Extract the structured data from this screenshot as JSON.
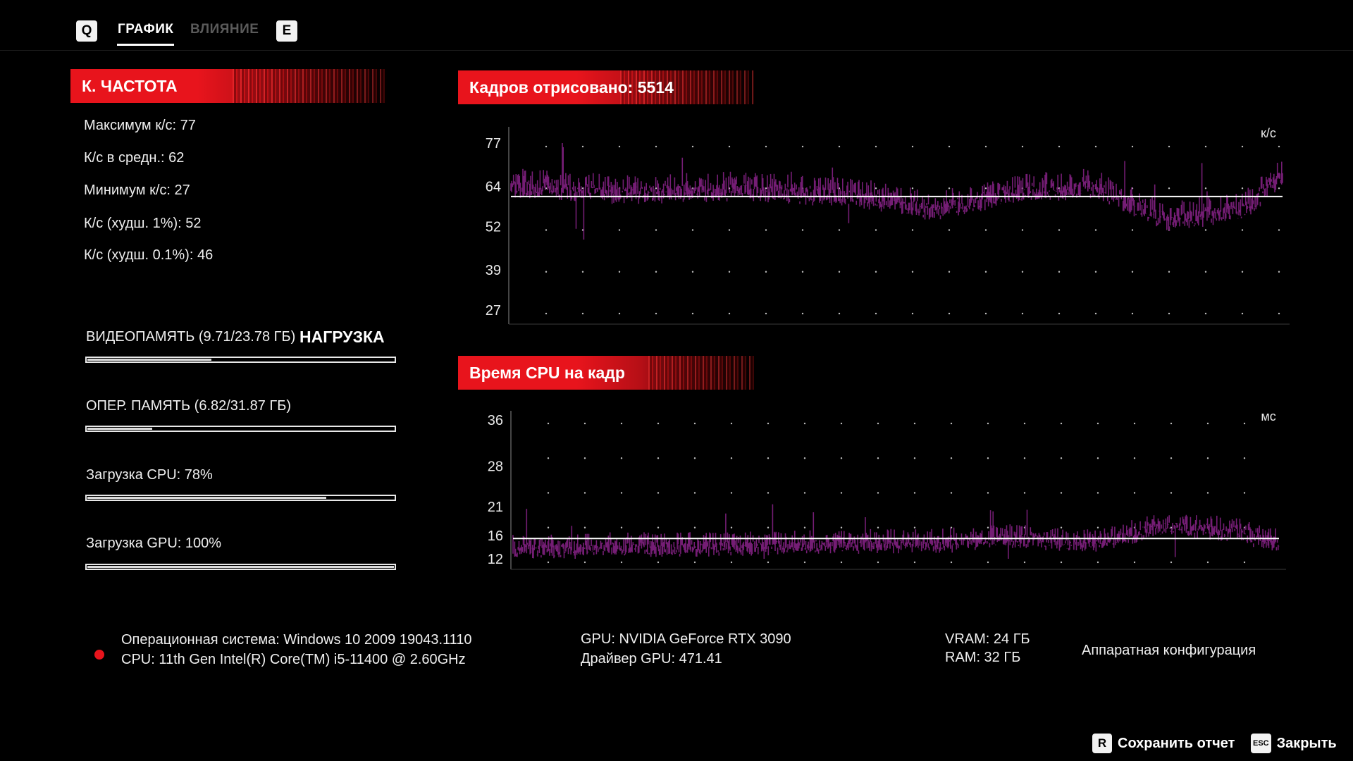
{
  "tabs": {
    "prev_key": "Q",
    "next_key": "E",
    "items": [
      {
        "label": "ГРАФИК",
        "active": true
      },
      {
        "label": "ВЛИЯНИЕ",
        "active": false
      }
    ]
  },
  "fps_section": {
    "title": "К. ЧАСТОТА",
    "stats": [
      "Максимум к/с: 77",
      "К/с в средн.: 62",
      "Минимум к/с: 27",
      "К/с (худш. 1%): 52",
      "К/с (худш. 0.1%): 46"
    ]
  },
  "load_section": {
    "title": "НАГРУЗКА",
    "bars": [
      {
        "label": "ВИДЕОПАМЯТЬ (9.71/23.78 ГБ)",
        "fraction": 0.408
      },
      {
        "label": "ОПЕР. ПАМЯТЬ (6.82/31.87 ГБ)",
        "fraction": 0.214
      },
      {
        "label": "Загрузка CPU: 78%",
        "fraction": 0.78
      },
      {
        "label": "Загрузка GPU: 100%",
        "fraction": 1.0
      }
    ]
  },
  "chart_data": [
    {
      "type": "line",
      "title": "Кадров отрисовано: 5514",
      "unit": "к/с",
      "yticks": [
        77,
        64,
        52,
        39,
        27
      ],
      "ylim": [
        27,
        77
      ],
      "average": 61,
      "series_color": "#7a1f7a",
      "average_color": "#ffffff",
      "segments": [
        {
          "x": [
            0,
            0.15,
            0.3,
            0.45,
            0.55,
            0.65,
            0.755,
            0.85,
            0.95,
            1.0
          ],
          "mean": [
            65,
            63,
            64,
            62,
            58,
            63,
            65,
            55,
            58,
            68
          ]
        }
      ]
    },
    {
      "type": "line",
      "title": "Время CPU на кадр",
      "unit": "мс",
      "yticks": [
        36,
        28,
        21,
        16,
        12
      ],
      "ylim": [
        12,
        36
      ],
      "average": 15.5,
      "series_color": "#7a1f7a",
      "average_color": "#ffffff",
      "segments": [
        {
          "x": [
            0,
            0.15,
            0.3,
            0.45,
            0.55,
            0.65,
            0.755,
            0.85,
            0.95,
            1.0
          ],
          "mean": [
            14,
            14.5,
            14.5,
            15,
            15,
            16,
            15,
            18,
            17,
            15
          ]
        }
      ]
    }
  ],
  "system": {
    "os": "Операционная система: Windows 10 2009 19043.1110",
    "cpu": "CPU: 11th Gen Intel(R) Core(TM) i5-11400 @ 2.60GHz",
    "gpu": "GPU: NVIDIA GeForce RTX 3090",
    "driver": "Драйвер GPU: 471.41",
    "vram": "VRAM: 24 ГБ",
    "ram": "RAM: 32 ГБ",
    "hw_config": "Аппаратная конфигурация"
  },
  "actions": {
    "save_key": "R",
    "save_label": "Сохранить отчет",
    "close_key": "ESC",
    "close_label": "Закрыть"
  }
}
